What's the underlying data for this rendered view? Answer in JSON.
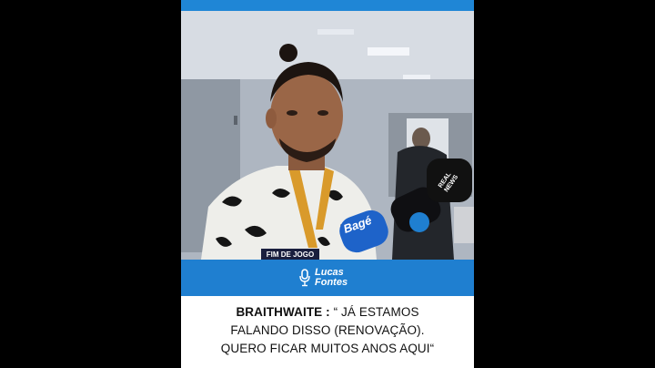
{
  "caption": {
    "speaker": "BRAITHWAITE :",
    "line1": " “ JÁ ESTAMOS",
    "line2": "FALANDO DISSO (RENOVAÇÃO).",
    "line3": "QUERO FICAR MUITOS ANOS AQUI“"
  },
  "brand": {
    "name_line1": "Lucas",
    "name_line2": "Fontes",
    "icon": "microphone-icon"
  },
  "overlay": {
    "lower_third": "FIM DE JOGO",
    "mic_logo": "Bagé",
    "mic_tag": "REAL NEWS"
  },
  "colors": {
    "accent": "#1f7fd0",
    "background": "#000000",
    "caption_bg": "#ffffff"
  }
}
